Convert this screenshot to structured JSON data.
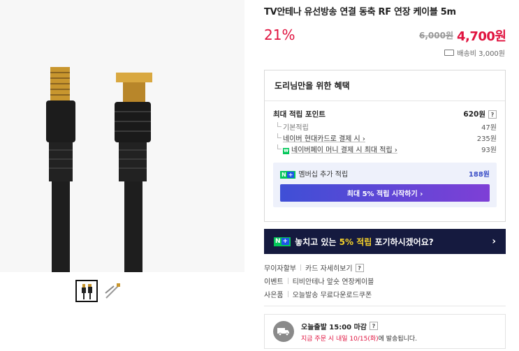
{
  "product": {
    "title": "TV안테나 유선방송 연결 동축 RF 연장 케이블 5m",
    "discount_rate": "21%",
    "original_price": "6,000원",
    "sale_price": "4,700원",
    "shipping": "배송비 3,000원"
  },
  "benefits": {
    "heading": "도리님만을 위한 혜택",
    "max_points_label": "최대 적립 포인트",
    "max_points_value": "620원",
    "items": [
      {
        "label": "기본적립",
        "value": "47원"
      },
      {
        "label": "네이버 현대카드로 결제 시 ›",
        "value": "235원"
      },
      {
        "label": "네이버페이 머니 결제 시 최대 적립 ›",
        "value": "93원",
        "badge": "₩"
      }
    ],
    "membership_label": "멤버십 추가 적립",
    "membership_value": "188원",
    "membership_badge_n": "N",
    "membership_badge_plus": "+",
    "start_button": "최대 5% 적립 시작하기 ›"
  },
  "promo": {
    "badge_n": "N",
    "badge_plus": "+",
    "text_before": "놓치고 있는 ",
    "highlight": "5% 적립",
    "text_after": " 포기하시겠어요?",
    "arrow": "›"
  },
  "info": [
    {
      "key": "무이자할부",
      "value": "카드 자세히보기",
      "help": "?"
    },
    {
      "key": "이벤트",
      "value": "티비안테나 앞숏 연장케이블"
    },
    {
      "key": "사은품",
      "value": "오늘발송 무료다운로드쿠폰"
    }
  ],
  "delivery": {
    "title": "오늘출발 15:00 마감",
    "help": "?",
    "sub_red": "지금 주문 시 내일 10/15(화)",
    "sub_gray": "에 발송됩니다."
  },
  "help_icon": "?",
  "colors": {
    "accent_red": "#e0133f",
    "naver_green": "#03c75a",
    "banner_navy": "#151a3f",
    "highlight_yellow": "#f5d12a"
  }
}
